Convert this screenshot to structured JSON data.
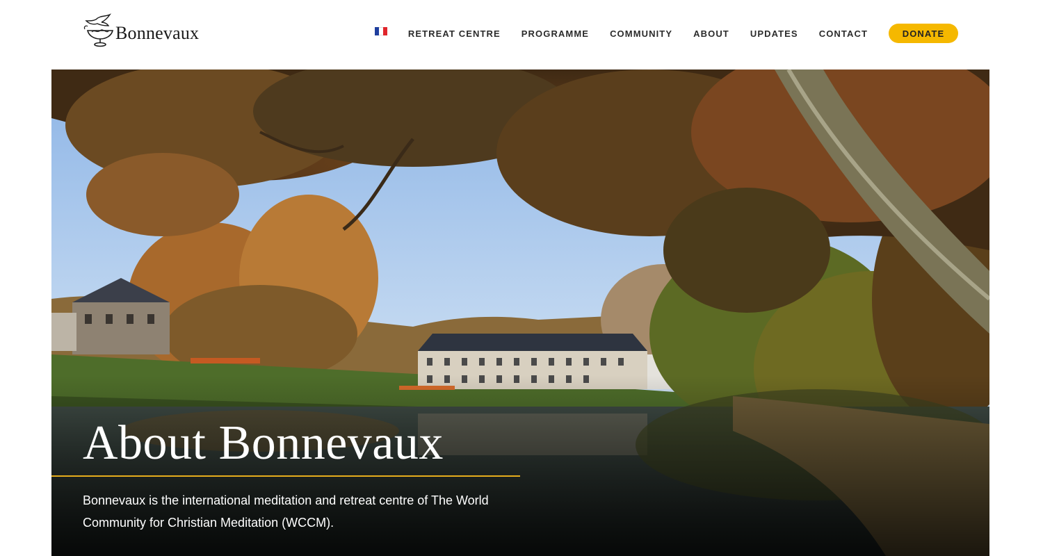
{
  "brand": {
    "name": "Bonnevaux",
    "logo_icon": "dove-chalice-logo-icon"
  },
  "nav": {
    "language_flag": "french-flag-icon",
    "flag_colors": [
      "#1f3f9e",
      "#ffffff",
      "#e0252b"
    ],
    "items": [
      {
        "label": "RETREAT CENTRE"
      },
      {
        "label": "PROGRAMME"
      },
      {
        "label": "COMMUNITY"
      },
      {
        "label": "ABOUT"
      },
      {
        "label": "UPDATES"
      },
      {
        "label": "CONTACT"
      }
    ],
    "donate_label": "DONATE",
    "donate_color": "#f5b800"
  },
  "hero": {
    "title": "About Bonnevaux",
    "description": "Bonnevaux is the international meditation and retreat centre of The World Community for Christian Meditation (WCCM).",
    "accent_color": "#e6ad1c"
  }
}
